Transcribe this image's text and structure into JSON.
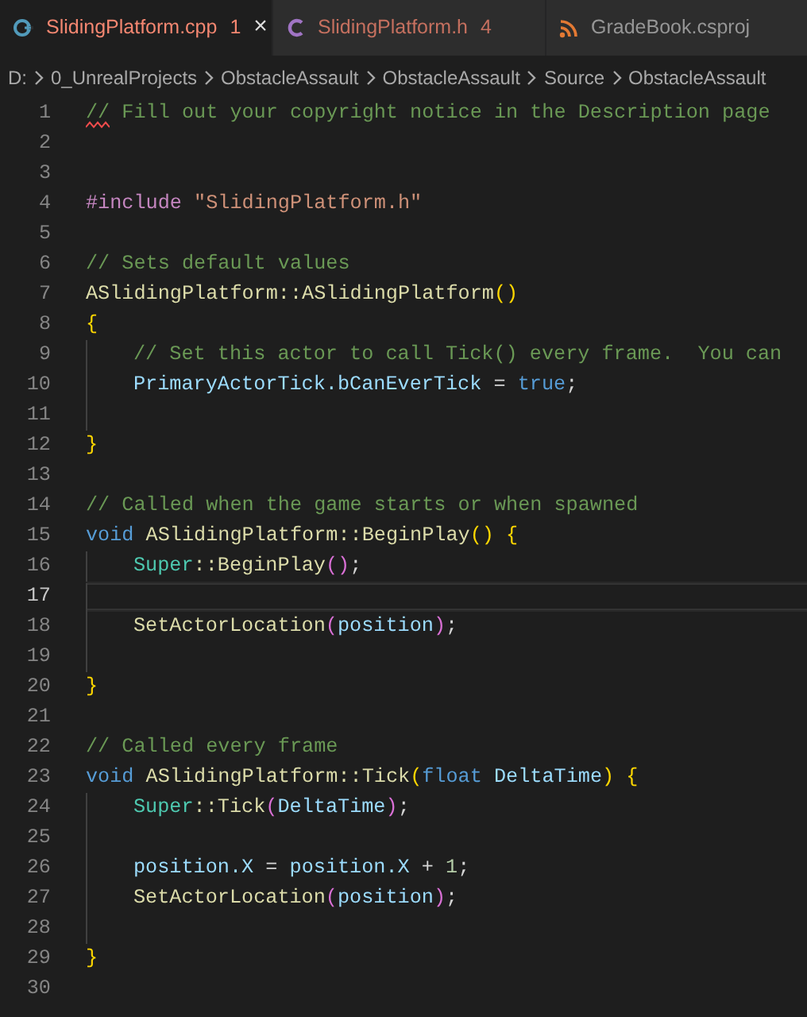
{
  "tabs": [
    {
      "kind": "cpp",
      "label": "SlidingPlatform.cpp",
      "problems": "1",
      "close": "×",
      "selected": true,
      "error": true
    },
    {
      "kind": "c",
      "label": "SlidingPlatform.h",
      "problems": "4",
      "selected": false,
      "error": true
    },
    {
      "kind": "rss",
      "label": "GradeBook.csproj",
      "selected": false,
      "error": false
    }
  ],
  "breadcrumb": [
    "D:",
    "0_UnrealProjects",
    "ObstacleAssault",
    "ObstacleAssault",
    "Source",
    "ObstacleAssault"
  ],
  "lines": [
    {
      "number": "1",
      "current": false,
      "indented": false,
      "error": true,
      "tokens": [
        {
          "kind": "comment",
          "text": "// Fill out your copyright notice in the Description page"
        }
      ]
    },
    {
      "number": "2",
      "current": false,
      "indented": false,
      "error": false
    },
    {
      "number": "3",
      "current": false,
      "indented": false,
      "error": false
    },
    {
      "number": "4",
      "current": false,
      "indented": false,
      "error": false,
      "tokens": [
        {
          "kind": "preproc",
          "text": "#include"
        },
        {
          "kind": "string",
          "text": " \"SlidingPlatform.h\""
        }
      ]
    },
    {
      "number": "5",
      "current": false,
      "indented": false,
      "error": false
    },
    {
      "number": "6",
      "current": false,
      "indented": false,
      "error": false,
      "tokens": [
        {
          "kind": "comment",
          "text": "// Sets default values"
        }
      ]
    },
    {
      "number": "7",
      "current": false,
      "indented": false,
      "error": false,
      "tokens": [
        {
          "kind": "function",
          "text": "ASlidingPlatform::ASlidingPlatform"
        },
        {
          "kind": "bracket1",
          "text": "()"
        }
      ]
    },
    {
      "number": "8",
      "current": false,
      "indented": false,
      "error": false,
      "tokens": [
        {
          "kind": "bracket1",
          "text": "{"
        }
      ]
    },
    {
      "number": "9",
      "current": false,
      "indented": true,
      "error": false,
      "tokens": [
        {
          "kind": "comment",
          "text": "// Set this actor to call Tick() every frame.  You can"
        }
      ]
    },
    {
      "number": "10",
      "current": false,
      "indented": true,
      "error": false,
      "tokens": [
        {
          "kind": "variable",
          "text": "PrimaryActorTick.bCanEverTick"
        },
        {
          "kind": "punct",
          "text": " = "
        },
        {
          "kind": "keyword",
          "text": "true"
        },
        {
          "kind": "punct",
          "text": ";"
        }
      ]
    },
    {
      "number": "11",
      "current": false,
      "indented": true,
      "error": false
    },
    {
      "number": "12",
      "current": false,
      "indented": false,
      "error": false,
      "tokens": [
        {
          "kind": "bracket1",
          "text": "}"
        }
      ]
    },
    {
      "number": "13",
      "current": false,
      "indented": false,
      "error": false
    },
    {
      "number": "14",
      "current": false,
      "indented": false,
      "error": false,
      "tokens": [
        {
          "kind": "comment",
          "text": "// Called when the game starts or when spawned"
        }
      ]
    },
    {
      "number": "15",
      "current": false,
      "indented": false,
      "error": false,
      "tokens": [
        {
          "kind": "keyword",
          "text": "void"
        },
        {
          "kind": "function",
          "text": " ASlidingPlatform::BeginPlay"
        },
        {
          "kind": "bracket1",
          "text": "() {"
        }
      ]
    },
    {
      "number": "16",
      "current": false,
      "indented": true,
      "error": false,
      "tokens": [
        {
          "kind": "type",
          "text": "Super"
        },
        {
          "kind": "function",
          "text": "::BeginPlay"
        },
        {
          "kind": "bracket2",
          "text": "()"
        },
        {
          "kind": "punct",
          "text": ";"
        }
      ]
    },
    {
      "number": "17",
      "current": true,
      "indented": true,
      "error": false
    },
    {
      "number": "18",
      "current": false,
      "indented": true,
      "error": false,
      "tokens": [
        {
          "kind": "function",
          "text": "SetActorLocation"
        },
        {
          "kind": "bracket2",
          "text": "("
        },
        {
          "kind": "variable",
          "text": "position"
        },
        {
          "kind": "bracket2",
          "text": ")"
        },
        {
          "kind": "punct",
          "text": ";"
        }
      ]
    },
    {
      "number": "19",
      "current": false,
      "indented": true,
      "error": false
    },
    {
      "number": "20",
      "current": false,
      "indented": false,
      "error": false,
      "tokens": [
        {
          "kind": "bracket1",
          "text": "}"
        }
      ]
    },
    {
      "number": "21",
      "current": false,
      "indented": false,
      "error": false
    },
    {
      "number": "22",
      "current": false,
      "indented": false,
      "error": false,
      "tokens": [
        {
          "kind": "comment",
          "text": "// Called every frame"
        }
      ]
    },
    {
      "number": "23",
      "current": false,
      "indented": false,
      "error": false,
      "tokens": [
        {
          "kind": "keyword",
          "text": "void"
        },
        {
          "kind": "function",
          "text": " ASlidingPlatform::Tick"
        },
        {
          "kind": "bracket1",
          "text": "("
        },
        {
          "kind": "keyword",
          "text": "float"
        },
        {
          "kind": "variable",
          "text": " DeltaTime"
        },
        {
          "kind": "bracket1",
          "text": ") {"
        }
      ]
    },
    {
      "number": "24",
      "current": false,
      "indented": true,
      "error": false,
      "tokens": [
        {
          "kind": "type",
          "text": "Super"
        },
        {
          "kind": "function",
          "text": "::Tick"
        },
        {
          "kind": "bracket2",
          "text": "("
        },
        {
          "kind": "variable",
          "text": "DeltaTime"
        },
        {
          "kind": "bracket2",
          "text": ")"
        },
        {
          "kind": "punct",
          "text": ";"
        }
      ]
    },
    {
      "number": "25",
      "current": false,
      "indented": true,
      "error": false
    },
    {
      "number": "26",
      "current": false,
      "indented": true,
      "error": false,
      "tokens": [
        {
          "kind": "variable",
          "text": "position.X"
        },
        {
          "kind": "punct",
          "text": " = "
        },
        {
          "kind": "variable",
          "text": "position.X"
        },
        {
          "kind": "punct",
          "text": " + "
        },
        {
          "kind": "number",
          "text": "1"
        },
        {
          "kind": "punct",
          "text": ";"
        }
      ]
    },
    {
      "number": "27",
      "current": false,
      "indented": true,
      "error": false,
      "tokens": [
        {
          "kind": "function",
          "text": "SetActorLocation"
        },
        {
          "kind": "bracket2",
          "text": "("
        },
        {
          "kind": "variable",
          "text": "position"
        },
        {
          "kind": "bracket2",
          "text": ")"
        },
        {
          "kind": "punct",
          "text": ";"
        }
      ]
    },
    {
      "number": "28",
      "current": false,
      "indented": true,
      "error": false
    },
    {
      "number": "29",
      "current": false,
      "indented": false,
      "error": false,
      "tokens": [
        {
          "kind": "bracket1",
          "text": "}"
        }
      ]
    },
    {
      "number": "30",
      "current": false,
      "indented": false,
      "error": false
    }
  ]
}
